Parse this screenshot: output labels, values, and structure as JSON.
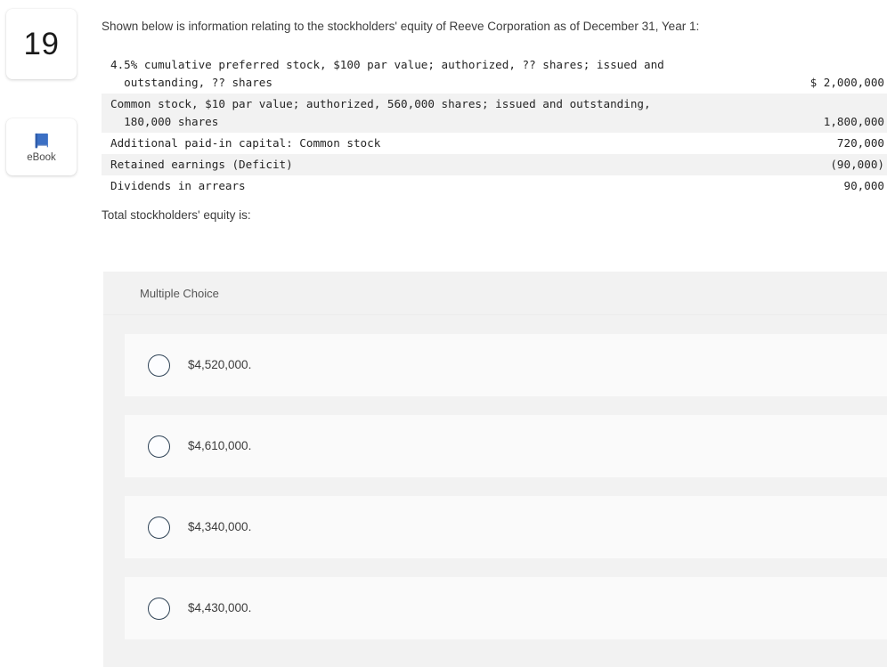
{
  "question": {
    "number": "19",
    "intro": "Shown below is information relating to the stockholders' equity of Reeve Corporation as of December 31, Year 1:",
    "prompt": "Total stockholders' equity is:"
  },
  "tools": {
    "ebook": {
      "label": "eBook",
      "icon": "book-icon",
      "color": "#3b6fc4"
    }
  },
  "equity_table": {
    "rows": [
      {
        "description": "4.5% cumulative preferred stock, $100 par value; authorized, ?? shares; issued and\n  outstanding, ?? shares",
        "amount": "$ 2,000,000",
        "shaded": false
      },
      {
        "description": "Common stock, $10 par value; authorized, 560,000 shares; issued and outstanding,\n  180,000 shares",
        "amount": "1,800,000",
        "shaded": true
      },
      {
        "description": "Additional paid-in capital: Common stock",
        "amount": "720,000",
        "shaded": false
      },
      {
        "description": "Retained earnings (Deficit)",
        "amount": "(90,000)",
        "shaded": true
      },
      {
        "description": "Dividends in arrears",
        "amount": "90,000",
        "shaded": false
      }
    ]
  },
  "multiple_choice": {
    "header": "Multiple Choice",
    "options": [
      {
        "label": "$4,520,000.",
        "selected": false
      },
      {
        "label": "$4,610,000.",
        "selected": false
      },
      {
        "label": "$4,340,000.",
        "selected": false
      },
      {
        "label": "$4,430,000.",
        "selected": false
      }
    ]
  },
  "colors": {
    "panel_bg": "#f2f2f2",
    "option_bg": "#fafafa",
    "radio_border": "#2f4356",
    "text": "#3c3c3c"
  }
}
